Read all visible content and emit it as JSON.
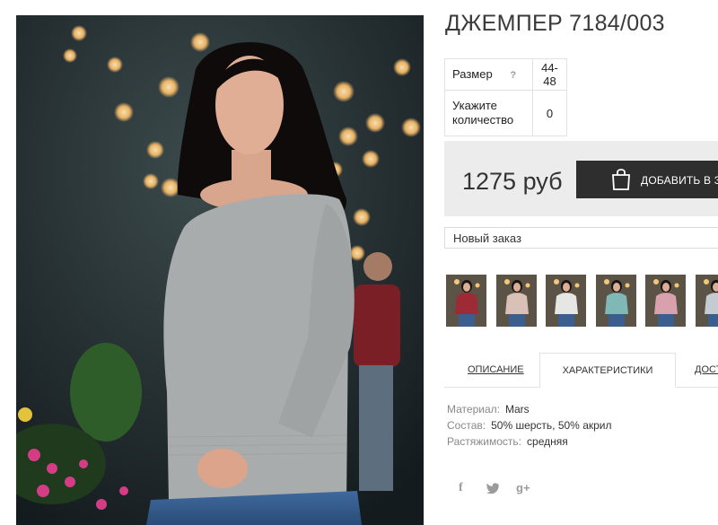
{
  "product": {
    "title": "ДЖЕМПЕР 7184/003",
    "photo_icon": "model-photo"
  },
  "params": {
    "size_label": "Размер",
    "size_help": "?",
    "size_value": "44-48",
    "qty_label": "Укажите количество",
    "qty_value": "0"
  },
  "buy": {
    "price": "1275 руб",
    "add_label": "ДОБАВИТЬ В ЗА",
    "bag_icon": "shopping-bag-icon"
  },
  "order": {
    "selected": "Новый заказ"
  },
  "thumbnails": [
    {
      "color": "#9e2a36"
    },
    {
      "color": "#d9c1b7"
    },
    {
      "color": "#e6e6e4"
    },
    {
      "color": "#7fb8b5"
    },
    {
      "color": "#d9a0ad"
    },
    {
      "color": "#c4ccd2"
    }
  ],
  "tabs": {
    "description": "ОПИСАНИЕ",
    "characteristics": "ХАРАКТЕРИСТИКИ",
    "delivery": "ДОСТ"
  },
  "specs": {
    "material_label": "Материал:",
    "material_value": "Mars",
    "composition_label": "Состав:",
    "composition_value": "50% шерсть, 50% акрил",
    "stretch_label": "Растяжимость:",
    "stretch_value": "средняя"
  },
  "social": {
    "facebook": "f",
    "twitter": "twitter-icon",
    "google": "g+"
  },
  "colors": {
    "button": "#2e2e2e",
    "buybox": "#ececec",
    "sweater": "#a9acad"
  }
}
